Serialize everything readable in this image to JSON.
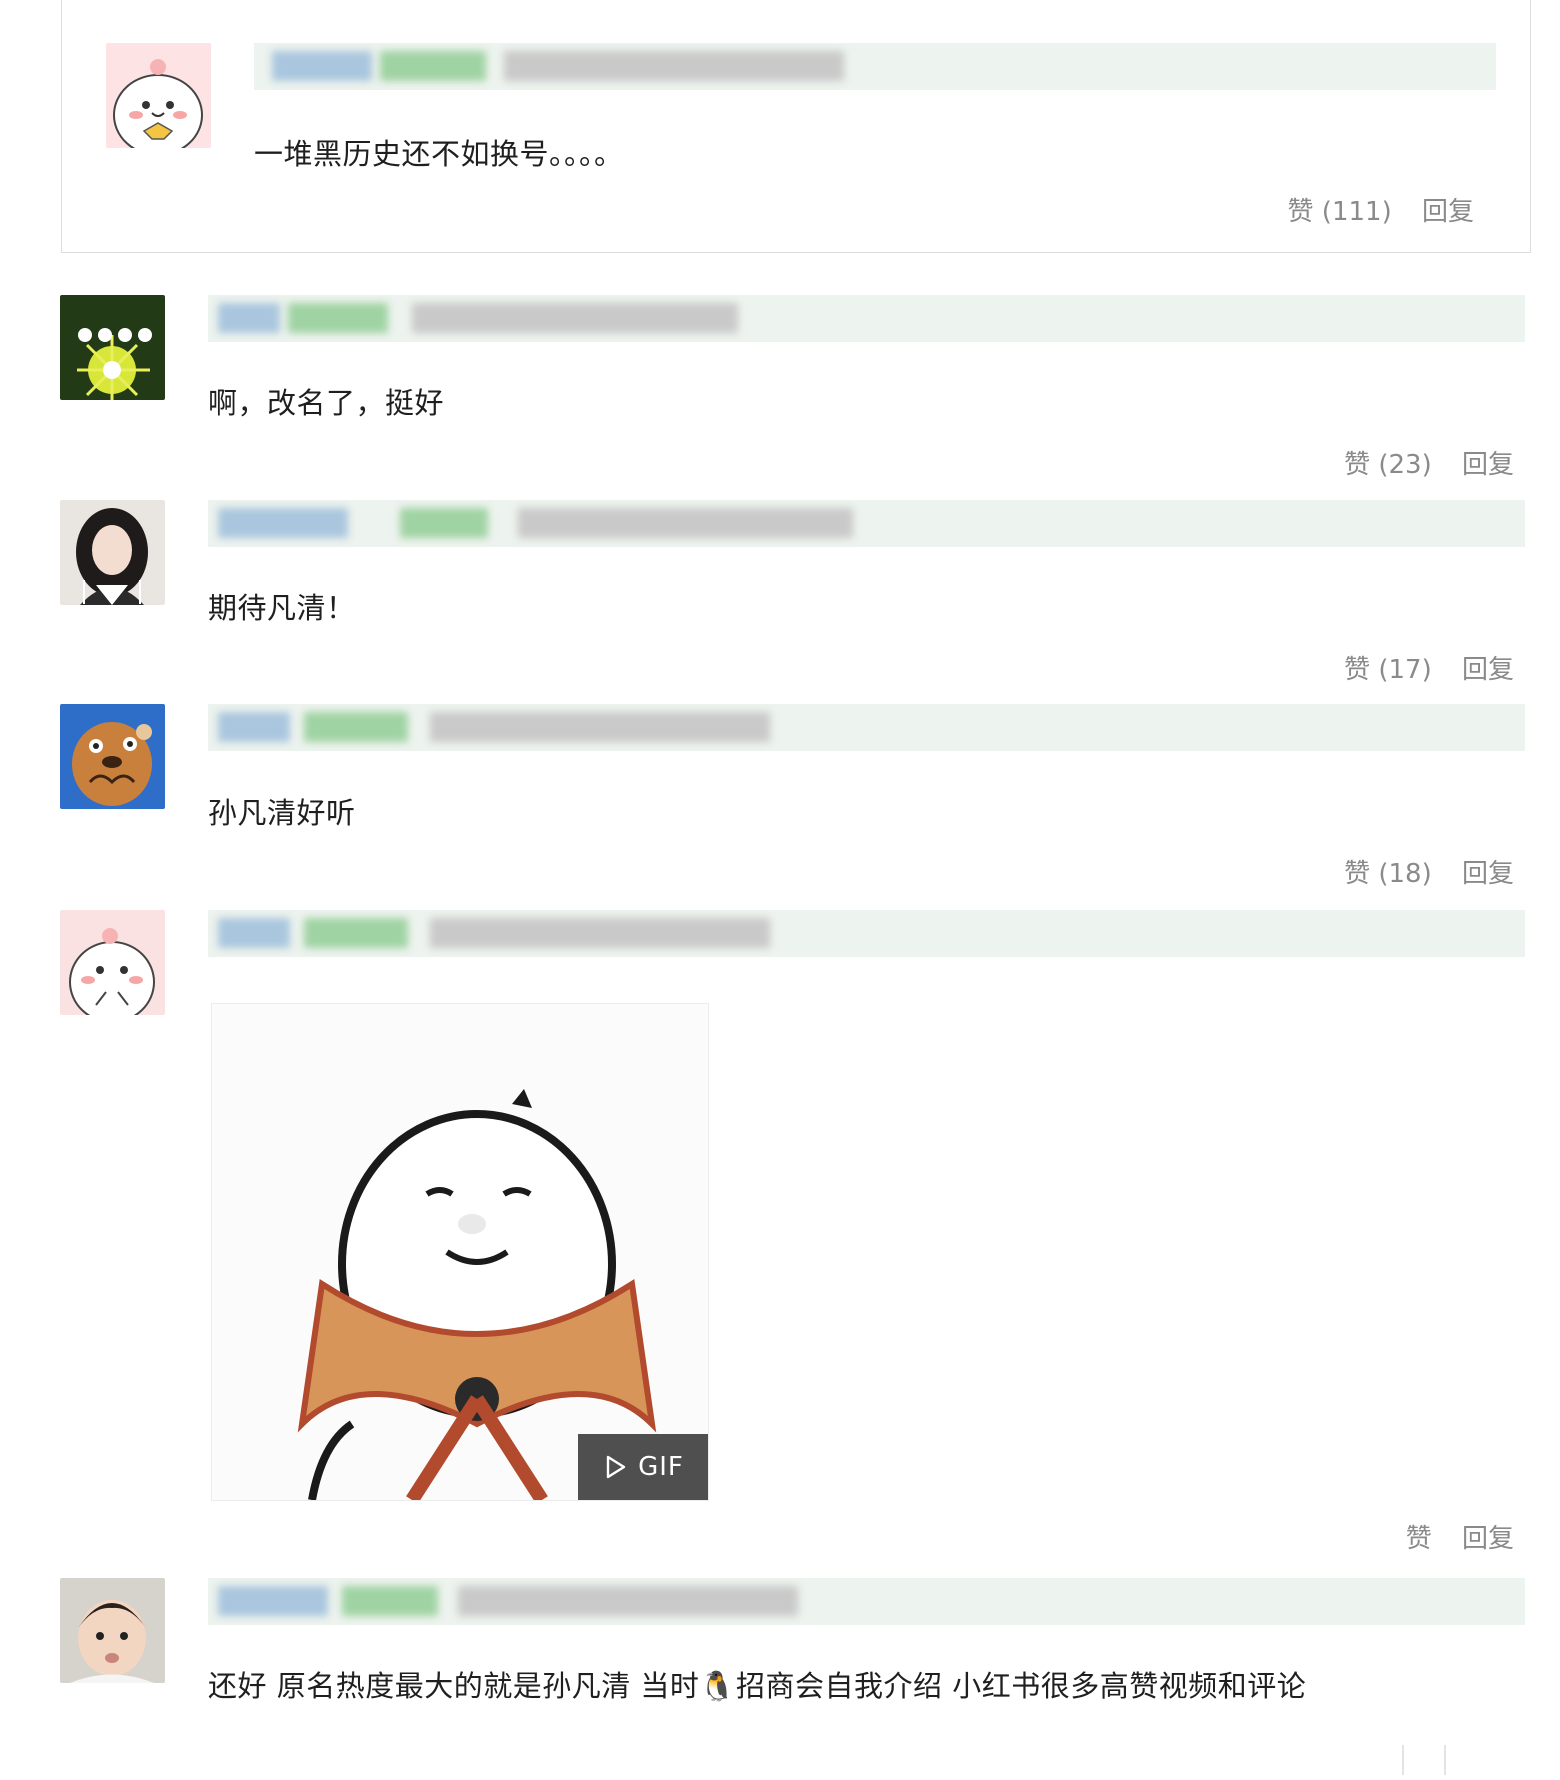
{
  "comments": [
    {
      "text": "一堆黑历史还不如换号。。。。",
      "like_label": "赞 (111)",
      "reply_label": "回复"
    },
    {
      "text": "啊，改名了，挺好",
      "like_label": "赞 (23)",
      "reply_label": "回复"
    },
    {
      "text": "期待凡清！",
      "like_label": "赞 (17)",
      "reply_label": "回复"
    },
    {
      "text": "孙凡清好听",
      "like_label": "赞 (18)",
      "reply_label": "回复"
    },
    {
      "gif_label": "GIF",
      "like_label": "赞",
      "reply_label": "回复"
    },
    {
      "text": "还好 原名热度最大的就是孙凡清 当时🐧招商会自我介绍 小红书很多高赞视频和评论"
    }
  ],
  "colors": {
    "meta_bar": "#edf3ee",
    "username_blur": "#a9c6de",
    "badge_blur": "#9fd3a3",
    "date_blur": "#c9c9c9",
    "action_text": "#8a8a8a"
  }
}
